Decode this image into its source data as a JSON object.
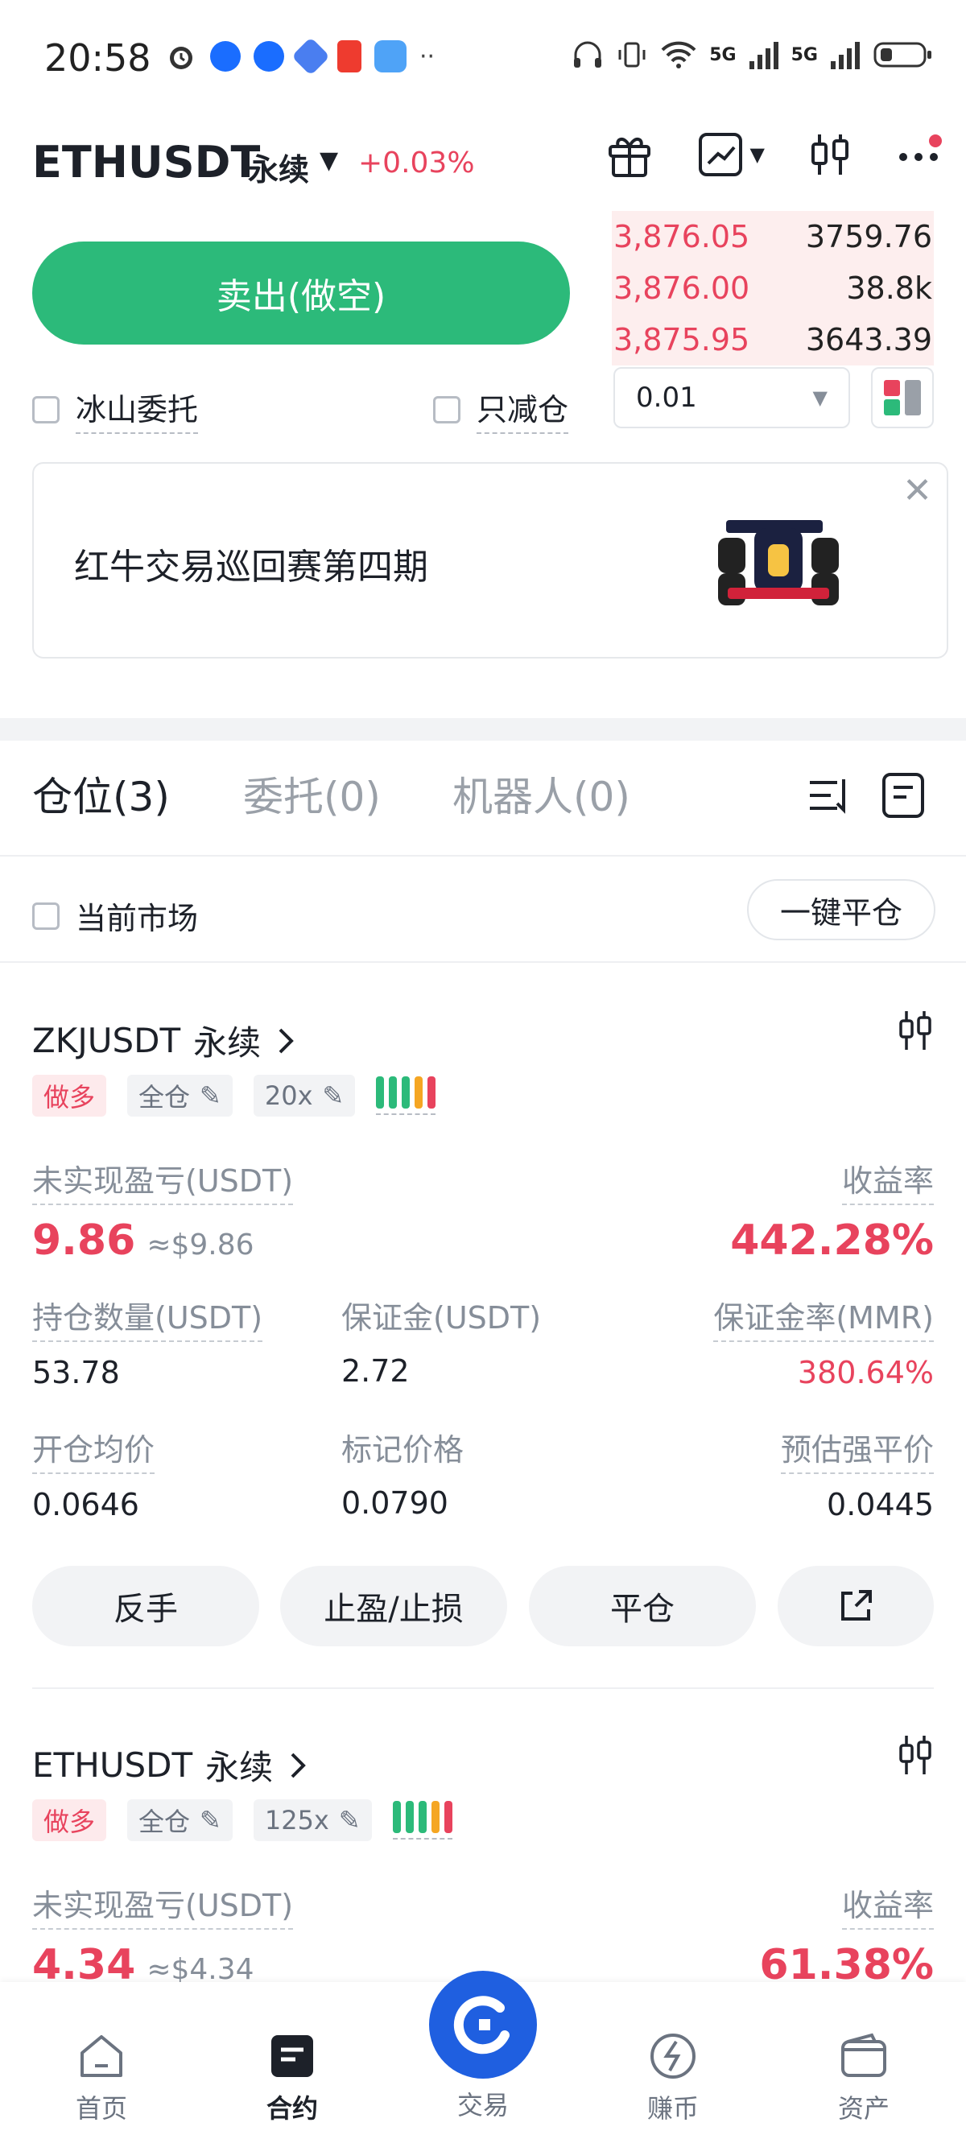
{
  "status_bar": {
    "time": "20:58",
    "network_1": "5G",
    "network_2": "5G"
  },
  "header": {
    "symbol": "ETHUSDT",
    "contract_type": "永续",
    "change": "+0.03%"
  },
  "trade_panel": {
    "sell_label": "卖出(做空)",
    "iceberg_label": "冰山委托",
    "reduce_only_label": "只减仓",
    "quantity_step": "0.01"
  },
  "order_book": {
    "asks": [
      {
        "price": "3,876.05",
        "qty": "3759.76"
      },
      {
        "price": "3,876.00",
        "qty": "38.8k"
      },
      {
        "price": "3,875.95",
        "qty": "3643.39"
      }
    ]
  },
  "banner": {
    "text": "红牛交易巡回赛第四期"
  },
  "tabs": [
    {
      "label": "仓位(3)",
      "active": true
    },
    {
      "label": "委托(0)",
      "active": false
    },
    {
      "label": "机器人(0)",
      "active": false
    }
  ],
  "filter": {
    "current_market_label": "当前市场",
    "close_all_label": "一键平仓"
  },
  "positions": [
    {
      "symbol": "ZKJUSDT",
      "contract_type": "永续",
      "side": "做多",
      "margin_mode": "全仓",
      "leverage": "20x",
      "unrealized_pnl_label": "未实现盈亏(USDT)",
      "unrealized_pnl": "9.86",
      "unrealized_pnl_usd": "≈$9.86",
      "roe_label": "收益率",
      "roe": "442.28%",
      "size_label": "持仓数量(USDT)",
      "size": "53.78",
      "margin_label": "保证金(USDT)",
      "margin": "2.72",
      "mmr_label": "保证金率(MMR)",
      "mmr": "380.64%",
      "entry_label": "开仓均价",
      "entry": "0.0646",
      "mark_label": "标记价格",
      "mark": "0.0790",
      "liq_label": "预估强平价",
      "liq": "0.0445",
      "actions": [
        "反手",
        "止盈/止损",
        "平仓"
      ]
    },
    {
      "symbol": "ETHUSDT",
      "contract_type": "永续",
      "side": "做多",
      "margin_mode": "全仓",
      "leverage": "125x",
      "unrealized_pnl_label": "未实现盈亏(USDT)",
      "unrealized_pnl": "4.34",
      "unrealized_pnl_usd": "≈$4.34",
      "roe_label": "收益率",
      "roe": "61.38%"
    }
  ],
  "bottom_nav": [
    {
      "label": "首页",
      "icon": "home-icon",
      "active": false
    },
    {
      "label": "合约",
      "icon": "contract-icon",
      "active": true
    },
    {
      "label": "交易",
      "icon": "trade-icon",
      "active": false
    },
    {
      "label": "赚币",
      "icon": "earn-icon",
      "active": false
    },
    {
      "label": "资产",
      "icon": "wallet-icon",
      "active": false
    }
  ],
  "colors": {
    "sell_green": "#2cba7a",
    "red": "#e8435d",
    "brand_blue": "#1f5fe0"
  }
}
